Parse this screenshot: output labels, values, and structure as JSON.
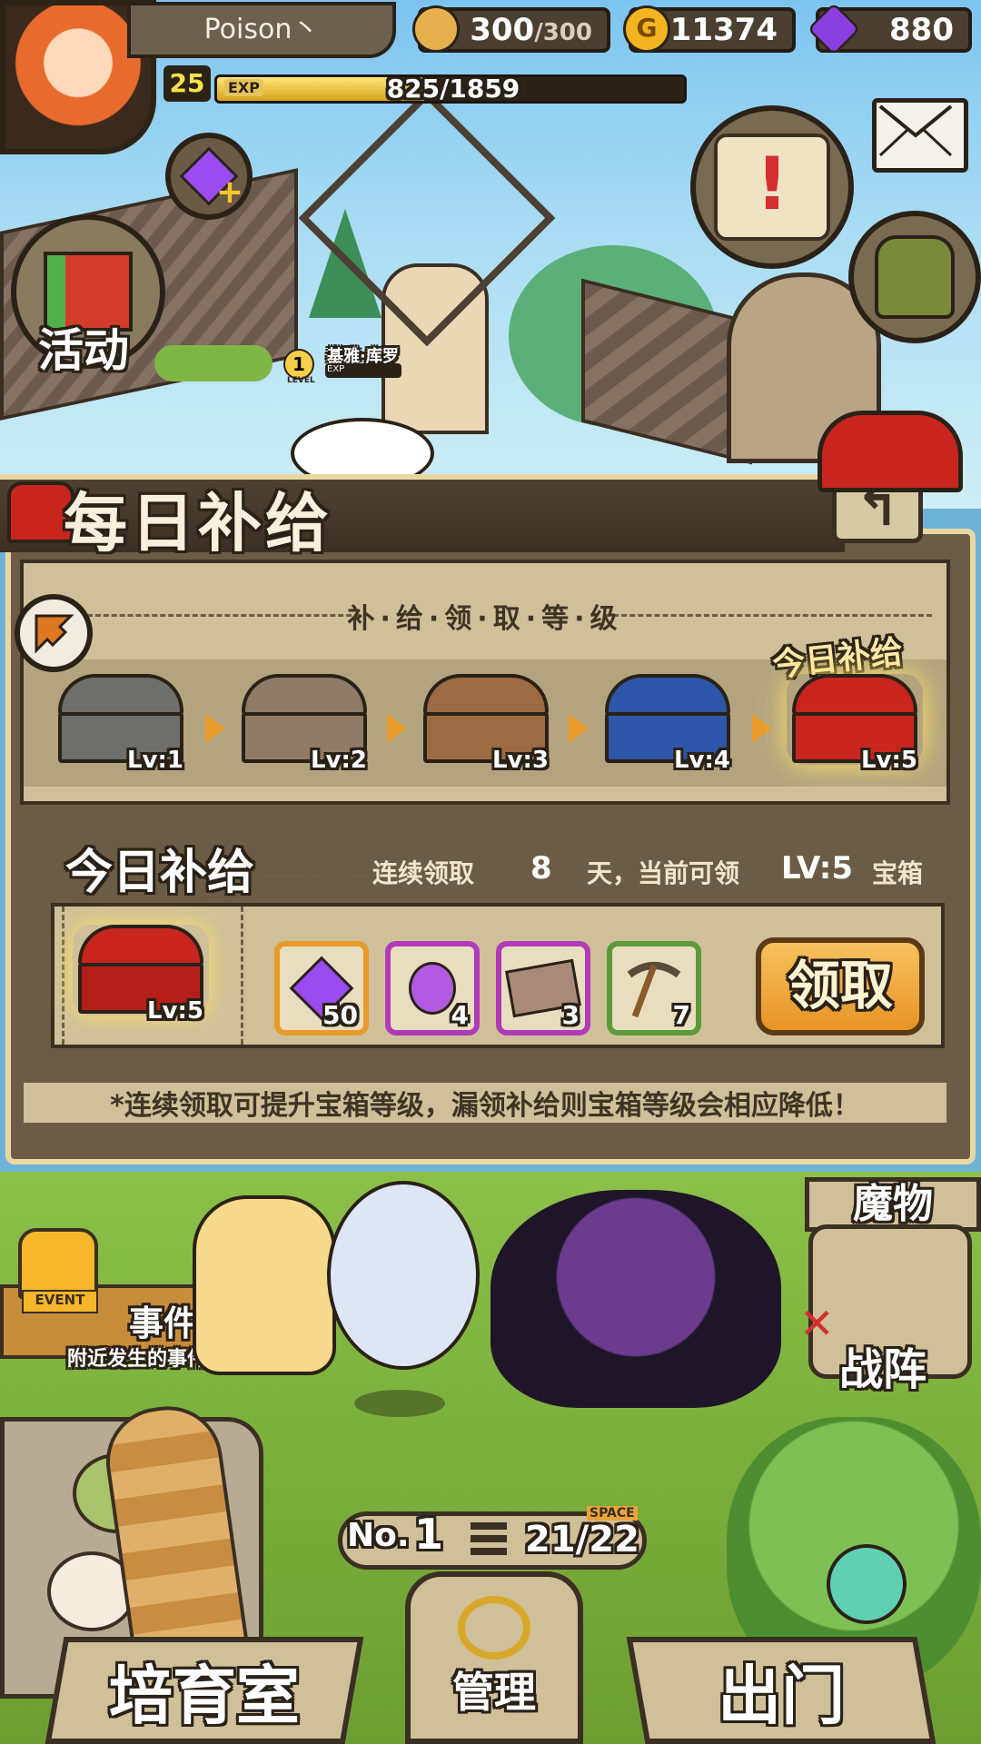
{
  "player": {
    "name": "Poison丶",
    "level": "25",
    "exp_label": "EXP",
    "exp_text": "825/1859",
    "exp_fraction": 0.444
  },
  "resources": {
    "stamina": {
      "value": "300",
      "max": "/300",
      "icon": "bread-icon"
    },
    "gold": {
      "value": "11374",
      "icon": "gold-coin-icon",
      "glyph": "G"
    },
    "gems": {
      "value": "880",
      "icon": "purple-gem-icon"
    }
  },
  "side_menu": {
    "events_label": "活动"
  },
  "npc": {
    "level": "1",
    "level_caption": "LEVEL",
    "name": "基雅·库罗",
    "exp_caption": "EXP"
  },
  "daily_supply": {
    "title": "每日补给",
    "levels_header": "补·给·领·取·等·级",
    "today_badge": "今日补给",
    "chests": [
      {
        "label": "Lv:1",
        "color": "#6e6e6a"
      },
      {
        "label": "Lv:2",
        "color": "#8f7b66"
      },
      {
        "label": "Lv:3",
        "color": "#9c6a43"
      },
      {
        "label": "Lv:4",
        "color": "#2e56a8"
      },
      {
        "label": "Lv:5",
        "color": "#c8251f"
      }
    ],
    "today_header": "今日补给",
    "streak_prefix": "连续领取",
    "streak_days": "8",
    "streak_suffix": "天，当前可领",
    "streak_level": "LV:5",
    "streak_box": "宝箱",
    "today_chest_label": "Lv:5",
    "rewards": [
      {
        "name": "purple-gem",
        "count": "50",
        "border": "#e89a2a"
      },
      {
        "name": "purple-potion",
        "count": "4",
        "border": "#b03ab8"
      },
      {
        "name": "ticket",
        "count": "3",
        "border": "#b03ab8"
      },
      {
        "name": "pickaxe",
        "count": "7",
        "border": "#5c9a3a"
      }
    ],
    "claim_label": "领取",
    "footnote": "*连续领取可提升宝箱等级，漏领补给则宝箱等级会相应降低！"
  },
  "field": {
    "monsters_tab": "魔物",
    "event_badge": "EVENT",
    "event_title": "事件!",
    "event_subtitle": "附近发生的事件",
    "formation_label": "战阵",
    "storage_no_prefix": "No.",
    "storage_no": "1",
    "space_caption": "SPACE",
    "space_value": "21/22"
  },
  "bottom_nav": {
    "nursery": "培育室",
    "manage": "管理",
    "go_out": "出门"
  }
}
